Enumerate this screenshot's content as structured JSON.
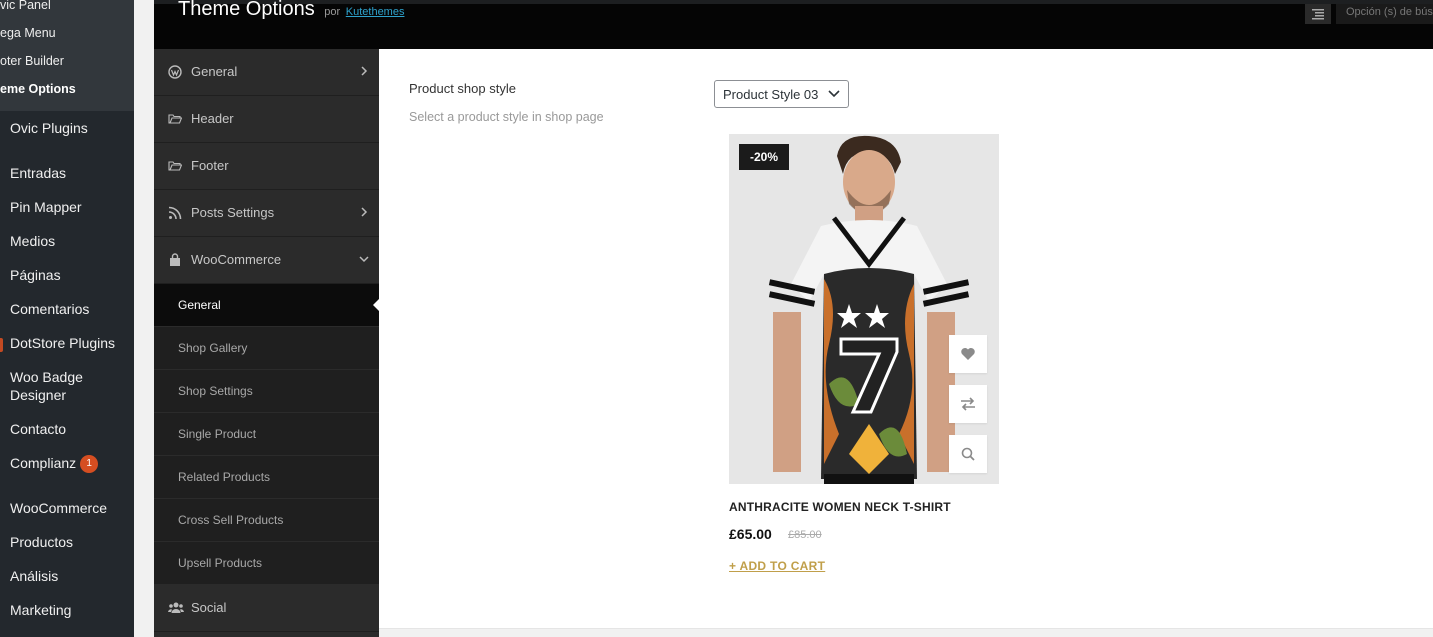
{
  "wp_sidebar": {
    "submenu": [
      {
        "label": "vic Panel"
      },
      {
        "label": "ega Menu"
      },
      {
        "label": "oter Builder"
      },
      {
        "label": "eme Options"
      }
    ],
    "menu": [
      {
        "label": "Ovic Plugins"
      },
      {
        "label": "Entradas"
      },
      {
        "label": "Pin Mapper"
      },
      {
        "label": "Medios"
      },
      {
        "label": "Páginas"
      },
      {
        "label": "Comentarios"
      },
      {
        "label": "DotStore Plugins"
      },
      {
        "label": "Woo Badge"
      },
      {
        "label": "Designer"
      },
      {
        "label": "Contacto"
      },
      {
        "label": "Complianz",
        "badge": "1"
      },
      {
        "label": "WooCommerce"
      },
      {
        "label": "Productos"
      },
      {
        "label": "Análisis"
      },
      {
        "label": "Marketing"
      }
    ]
  },
  "header": {
    "title": "Theme Options",
    "by": "por",
    "author": "Kutethemes",
    "search_placeholder": "Opción (s) de búsqueda"
  },
  "options_nav": {
    "sections": [
      {
        "label": "General",
        "icon": "wordpress-icon"
      },
      {
        "label": "Header",
        "icon": "folder-open-icon"
      },
      {
        "label": "Footer",
        "icon": "folder-open-icon"
      },
      {
        "label": "Posts Settings",
        "icon": "rss-icon"
      },
      {
        "label": "WooCommerce",
        "icon": "shopping-bag-icon"
      }
    ],
    "woo_subsections": [
      {
        "label": "General"
      },
      {
        "label": "Shop Gallery"
      },
      {
        "label": "Shop Settings"
      },
      {
        "label": "Single Product"
      },
      {
        "label": "Related Products"
      },
      {
        "label": "Cross Sell Products"
      },
      {
        "label": "Upsell Products"
      }
    ],
    "social": {
      "label": "Social",
      "icon": "users-icon"
    }
  },
  "field": {
    "title": "Product shop style",
    "description": "Select a product style in shop page",
    "selected": "Product Style 03"
  },
  "product_preview": {
    "badge": "-20%",
    "name": "ANTHRACITE WOMEN NECK T-SHIRT",
    "price": "£65.00",
    "old_price": "£85.00",
    "add_to_cart": "+ ADD TO CART",
    "actions": [
      "heart-icon",
      "compare-icon",
      "search-icon"
    ]
  },
  "colors": {
    "wp_sidebar": "#23282d",
    "header": "#050505",
    "nav": "#2b2b2b",
    "accent_link": "#c09f4a",
    "badge": "#d54e21"
  }
}
